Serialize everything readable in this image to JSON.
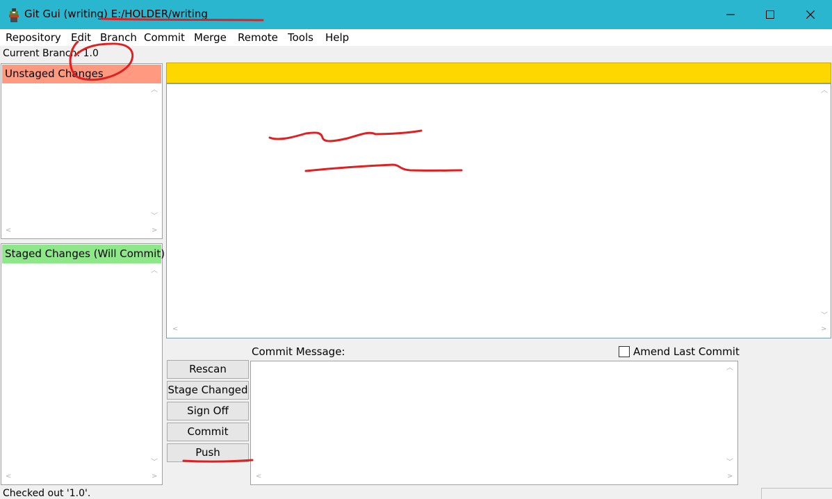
{
  "window": {
    "title": "Git Gui (writing) E:/HOLDER/writing",
    "controls": {
      "minimize": "—",
      "maximize": "☐",
      "close": "✕"
    }
  },
  "menu": [
    "Repository",
    "Edit",
    "Branch",
    "Commit",
    "Merge",
    "Remote",
    "Tools",
    "Help"
  ],
  "branch": {
    "text": "Current Branch: 1.0"
  },
  "unstaged": {
    "title": "Unstaged Changes"
  },
  "staged": {
    "title": "Staged Changes (Will Commit)"
  },
  "buttons": {
    "rescan": "Rescan",
    "stage_changed": "Stage Changed",
    "sign_off": "Sign Off",
    "commit": "Commit",
    "push": "Push"
  },
  "commit": {
    "label": "Commit Message:",
    "amend_label": "Amend Last Commit",
    "amend_checked": false
  },
  "status": {
    "text": "Checked out '1.0'."
  },
  "colors": {
    "titlebar": "#2bb6cf",
    "unstaged_header": "#ff9a80",
    "staged_header": "#8ee88a",
    "diff_header": "#ffd700",
    "annotation_red": "#e02020"
  }
}
